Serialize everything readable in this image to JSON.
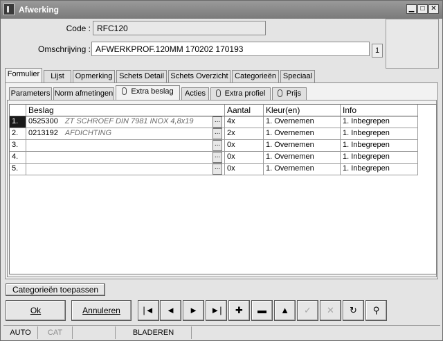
{
  "window": {
    "title": "Afwerking"
  },
  "form": {
    "code_label": "Code :",
    "code_value": "RFC120",
    "omschrijving_label": "Omschrijving :",
    "omschrijving_value": "AFWERKPROF.120MM 170202 170193",
    "count": "1"
  },
  "main_tabs": [
    {
      "label": "Formulier",
      "active": true
    },
    {
      "label": "Lijst"
    },
    {
      "label": "Opmerking"
    },
    {
      "label": "Schets Detail"
    },
    {
      "label": "Schets Overzicht"
    },
    {
      "label": "Categorieën"
    },
    {
      "label": "Speciaal"
    }
  ],
  "sub_tabs": [
    {
      "label": "Parameters"
    },
    {
      "label": "Norm afmetingen"
    },
    {
      "label": "Extra beslag",
      "clip": true,
      "active": true
    },
    {
      "label": "Acties"
    },
    {
      "label": "Extra profiel",
      "clip": true
    },
    {
      "label": "Prijs",
      "clip": true
    }
  ],
  "grid": {
    "headers": {
      "beslag": "Beslag",
      "aantal": "Aantal",
      "kleur": "Kleur(en)",
      "info": "Info"
    },
    "ellipsis": "...",
    "rows": [
      {
        "idx": "1.",
        "code": "0525300",
        "desc": "ZT SCHROEF DIN 7981 INOX 4,8x19",
        "aantal": "4x",
        "kleur": "1. Overnemen",
        "info": "1. Inbegrepen"
      },
      {
        "idx": "2.",
        "code": "0213192",
        "desc": "AFDICHTING",
        "aantal": "2x",
        "kleur": "1. Overnemen",
        "info": "1. Inbegrepen"
      },
      {
        "idx": "3.",
        "code": "",
        "desc": "",
        "aantal": "0x",
        "kleur": "1. Overnemen",
        "info": "1. Inbegrepen"
      },
      {
        "idx": "4.",
        "code": "",
        "desc": "",
        "aantal": "0x",
        "kleur": "1. Overnemen",
        "info": "1. Inbegrepen"
      },
      {
        "idx": "5.",
        "code": "",
        "desc": "",
        "aantal": "0x",
        "kleur": "1. Overnemen",
        "info": "1. Inbegrepen"
      }
    ]
  },
  "buttons": {
    "categorieen_toepassen": "Categorieën toepassen",
    "ok": "Ok",
    "annuleren": "Annuleren"
  },
  "nav_buttons": [
    {
      "name": "first-record-button",
      "glyph": "|◄"
    },
    {
      "name": "previous-record-button",
      "glyph": "◄"
    },
    {
      "name": "next-record-button",
      "glyph": "►"
    },
    {
      "name": "last-record-button",
      "glyph": "►|"
    },
    {
      "name": "add-record-button",
      "glyph": "✚"
    },
    {
      "name": "delete-record-button",
      "glyph": "▬"
    },
    {
      "name": "up-button",
      "glyph": "▲"
    },
    {
      "name": "confirm-button",
      "glyph": "✓",
      "disabled": true
    },
    {
      "name": "cancel-edit-button",
      "glyph": "✕",
      "disabled": true
    },
    {
      "name": "refresh-button",
      "glyph": "↻"
    },
    {
      "name": "search-button",
      "glyph": "⚲"
    }
  ],
  "status": {
    "auto": "AUTO",
    "cat": "CAT",
    "mode": "BLADEREN"
  }
}
